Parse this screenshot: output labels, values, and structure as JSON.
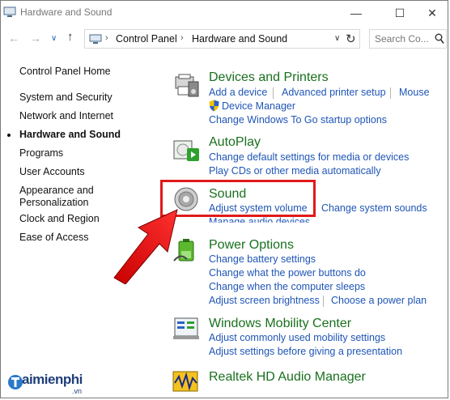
{
  "window": {
    "title": "Hardware and Sound"
  },
  "address": {
    "crumbs": [
      "Control Panel",
      "Hardware and Sound"
    ],
    "search_placeholder": "Search Co..."
  },
  "sidebar": {
    "items": [
      {
        "label": "Control Panel Home"
      },
      {
        "label": "System and Security"
      },
      {
        "label": "Network and Internet"
      },
      {
        "label": "Hardware and Sound"
      },
      {
        "label": "Programs"
      },
      {
        "label": "User Accounts"
      },
      {
        "label": "Appearance and"
      },
      {
        "label": "Personalization"
      },
      {
        "label": "Clock and Region"
      },
      {
        "label": "Ease of Access"
      }
    ]
  },
  "categories": {
    "devices": {
      "title": "Devices and Printers",
      "links": [
        "Add a device",
        "Advanced printer setup",
        "Mouse",
        "Device Manager",
        "Change Windows To Go startup options"
      ]
    },
    "autoplay": {
      "title": "AutoPlay",
      "links": [
        "Change default settings for media or devices",
        "Play CDs or other media automatically"
      ]
    },
    "sound": {
      "title": "Sound",
      "links": [
        "Adjust system volume",
        "Change system sounds",
        "Manage audio devices"
      ]
    },
    "power": {
      "title": "Power Options",
      "links": [
        "Change battery settings",
        "Change what the power buttons do",
        "Change when the computer sleeps",
        "Adjust screen brightness",
        "Choose a power plan"
      ]
    },
    "mobility": {
      "title": "Windows Mobility Center",
      "links": [
        "Adjust commonly used mobility settings",
        "Adjust settings before giving a presentation"
      ]
    },
    "realtek": {
      "title": "Realtek HD Audio Manager"
    }
  },
  "watermark": {
    "brand": "aimienphi",
    "suffix": ".vn"
  },
  "colors": {
    "link": "#1f55b6",
    "category_title": "#19701e",
    "highlight": "#e01a1a"
  }
}
